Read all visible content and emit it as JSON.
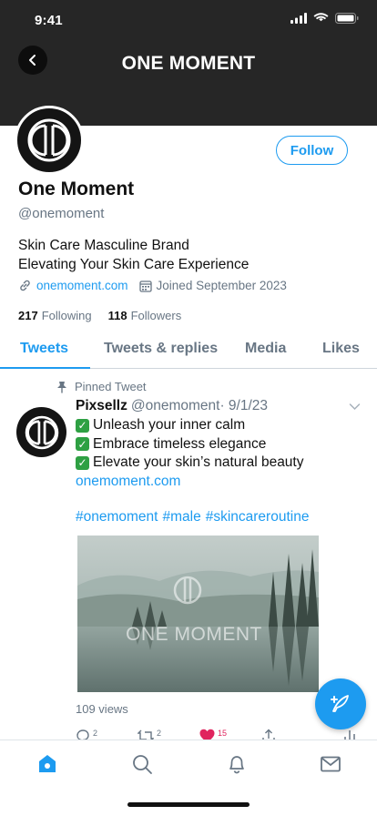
{
  "status_bar": {
    "time": "9:41"
  },
  "header": {
    "title": "ONE MOMENT"
  },
  "profile": {
    "follow_label": "Follow",
    "name": "One Moment",
    "handle": "@onemoment",
    "bio_line1": "Skin Care Masculine Brand",
    "bio_line2": "Elevating Your Skin Care Experience",
    "website": "onemoment.com",
    "joined": "Joined September 2023",
    "following_count": "217",
    "following_label": "Following",
    "followers_count": "118",
    "followers_label": "Followers"
  },
  "tabs": [
    {
      "label": "Tweets",
      "active": true
    },
    {
      "label": "Tweets & replies"
    },
    {
      "label": "Media"
    },
    {
      "label": "Likes"
    }
  ],
  "tweet": {
    "pinned_label": "Pinned Tweet",
    "author": "Pixsellz",
    "meta": "@onemoment· 9/1/23",
    "line1": "Unleash your inner calm",
    "line2": "Embrace timeless elegance",
    "line3": "Elevate your skin’s natural beauty",
    "link": "onemoment.com",
    "hashtags": [
      "#onemoment",
      "#male",
      "#skincareroutine"
    ],
    "image_text": "ONE MOMENT",
    "views": "109 views",
    "counts": {
      "replies": "2",
      "retweets": "2",
      "likes": "15"
    }
  },
  "colors": {
    "accent": "#1d9bf0",
    "header_bg": "#262626",
    "like": "#e0245e",
    "check": "#2ea043"
  },
  "icons": [
    "back-arrow-icon",
    "pin-icon",
    "link-icon",
    "calendar-icon",
    "chevron-down-icon",
    "reply-icon",
    "retweet-icon",
    "heart-icon",
    "share-icon",
    "analytics-icon",
    "compose-icon",
    "home-icon",
    "search-icon",
    "bell-icon",
    "mail-icon"
  ]
}
